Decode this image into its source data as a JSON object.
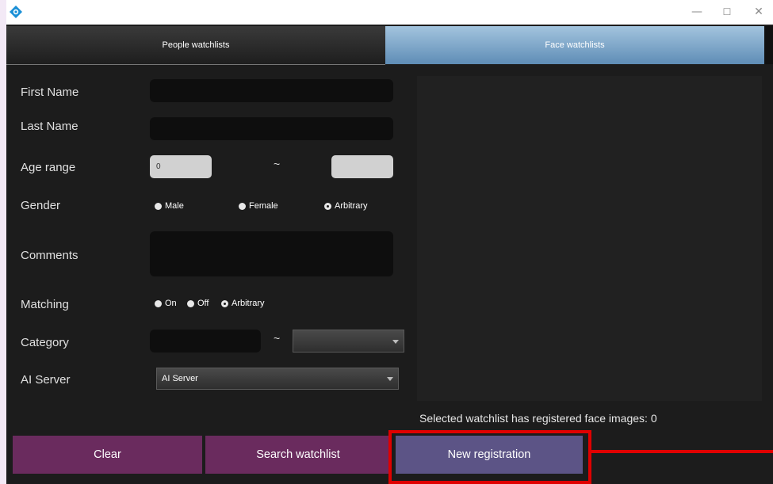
{
  "window": {
    "controls": {
      "minimize": "—",
      "maximize": "☐",
      "close": "✕"
    }
  },
  "tabs": [
    {
      "label": "People watchlists",
      "active": false
    },
    {
      "label": "Face watchlists",
      "active": true
    }
  ],
  "form": {
    "first_name": {
      "label": "First Name",
      "value": ""
    },
    "last_name": {
      "label": "Last Name",
      "value": ""
    },
    "age_range": {
      "label": "Age range",
      "from": "0",
      "separator": "~",
      "to": ""
    },
    "gender": {
      "label": "Gender",
      "options": [
        "Male",
        "Female",
        "Arbitrary"
      ],
      "selected": "Arbitrary"
    },
    "comments": {
      "label": "Comments",
      "value": ""
    },
    "matching": {
      "label": "Matching",
      "options": [
        "On",
        "Off",
        "Arbitrary"
      ],
      "selected": "Arbitrary"
    },
    "category": {
      "label": "Category",
      "separator": "~",
      "from": "",
      "to": ""
    },
    "ai_server": {
      "label": "AI Server",
      "selected": "AI Server"
    }
  },
  "status": {
    "registered_faces_text": "Selected watchlist has registered face images: 0"
  },
  "buttons": {
    "clear": "Clear",
    "search": "Search watchlist",
    "new_registration": "New registration"
  },
  "colors": {
    "accent_button": "#6a2b5e",
    "primary_button": "#5c5486",
    "highlight": "#e00000",
    "active_tab": "#7ea6c9"
  }
}
